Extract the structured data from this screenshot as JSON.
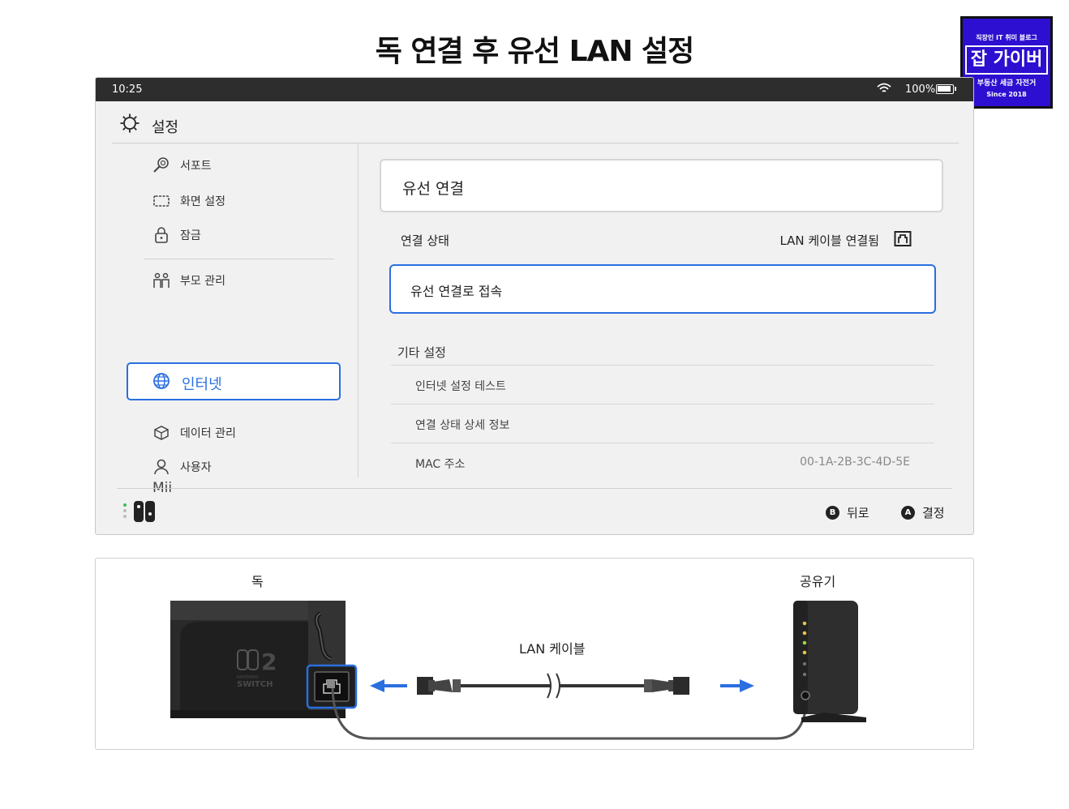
{
  "page_title": "독 연결 후 유선 LAN 설정",
  "badge": {
    "top": "직장인 IT 취미 블로그",
    "main": "잡 가이버",
    "sub": "부동산 세금 자전거",
    "since": "Since 2018"
  },
  "statusbar": {
    "time": "10:25",
    "battery": "100%",
    "wifi_icon": "wifi-icon",
    "battery_icon": "battery-icon"
  },
  "header": {
    "title": "설정",
    "icon": "gear-icon"
  },
  "sidebar": {
    "items": [
      {
        "label": "서포트",
        "icon": "magnifier-icon"
      },
      {
        "label": "화면 설정",
        "icon": "screen-icon"
      },
      {
        "label": "잠금",
        "icon": "lock-icon"
      },
      {
        "label": "부모 관리",
        "icon": "family-icon"
      },
      {
        "label": "인터넷",
        "icon": "globe-icon",
        "active": true
      },
      {
        "label": "데이터 관리",
        "icon": "box-icon"
      },
      {
        "label": "사용자",
        "icon": "user-icon"
      },
      {
        "label": "Mii"
      }
    ]
  },
  "main": {
    "card_title": "유선 연결",
    "status_label": "연결 상태",
    "status_value": "LAN 케이블 연결됨",
    "connect_button": "유선 연결로 접속",
    "other_title": "기타 설정",
    "other_rows": [
      {
        "label": "인터넷 설정 테스트",
        "value": ""
      },
      {
        "label": "연결 상태 상세 정보",
        "value": ""
      },
      {
        "label": "MAC 주소",
        "value": "00-1A-2B-3C-4D-5E"
      }
    ]
  },
  "footer": {
    "back": {
      "key": "B",
      "label": "뒤로"
    },
    "ok": {
      "key": "A",
      "label": "결정"
    }
  },
  "diagram": {
    "dock_label": "독",
    "router_label": "공유기",
    "cable_label": "LAN 케이블",
    "console_logo": "2",
    "console_brand": "SWITCH",
    "console_sub": "NINTENDO",
    "accent_color": "#2a6fe0"
  }
}
